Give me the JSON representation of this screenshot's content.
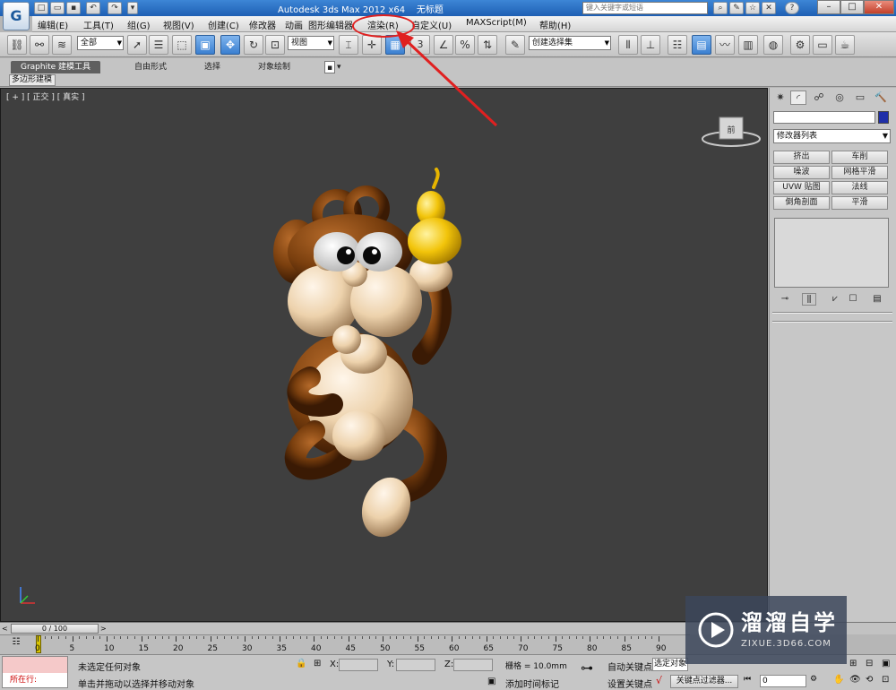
{
  "window": {
    "title": "Autodesk 3ds Max  2012 x64",
    "doc_title": "无标题",
    "search_placeholder": "键入关键字或短语",
    "help_icon": "question-icon",
    "logo_text": "G"
  },
  "menu": {
    "items": [
      "编辑(E)",
      "工具(T)",
      "组(G)",
      "视图(V)",
      "创建(C)",
      "修改器",
      "动画",
      "图形编辑器",
      "渲染(R)",
      "自定义(U)",
      "MAXScript(M)",
      "帮助(H)"
    ]
  },
  "toolbar": {
    "selection_filter": "全部",
    "ref_coord": "视图",
    "named_selection": "创建选择集",
    "snap_label": "3"
  },
  "ribbon": {
    "tabs": [
      "Graphite 建模工具",
      "自由形式",
      "选择",
      "对象绘制"
    ],
    "sub_tab": "多边形建模"
  },
  "viewport": {
    "label": "[ + ] [ 正交 ] [ 真实 ]",
    "viewcube_label": "前"
  },
  "command_panel": {
    "modifier_list": "修改器列表",
    "buttons": [
      "挤出",
      "车削",
      "噪波",
      "网格平滑",
      "UVW 贴图",
      "法线",
      "倒角剖面",
      "平滑"
    ],
    "object_color": "#1f2fa8"
  },
  "timeline": {
    "slider": "0 / 100",
    "ticks": [
      "0",
      "5",
      "10",
      "15",
      "20",
      "25",
      "30",
      "35",
      "40",
      "45",
      "50",
      "55",
      "60",
      "65",
      "70",
      "75",
      "80",
      "85",
      "90"
    ]
  },
  "status": {
    "maxscript_label": "所在行:",
    "selection_msg": "未选定任何对象",
    "prompt_msg": "单击并拖动以选择并移动对象",
    "x_label": "X:",
    "y_label": "Y:",
    "z_label": "Z:",
    "grid": "栅格 = 10.0mm",
    "add_time_tag": "添加时间标记",
    "auto_key": "自动关键点",
    "selected_object": "选定对象",
    "set_key": "设置关键点",
    "key_filters": "关键点过滤器...",
    "frame": "0"
  },
  "watermark": {
    "main": "溜溜自学",
    "sub": "ZIXUE.3D66.COM"
  },
  "colors": {
    "viewport_bg": "#3f3f3f",
    "annotation": "#e02020",
    "monkey_fur": "#7a3f0e",
    "monkey_skin": "#edd2ac",
    "gourd": "#f2c40a"
  }
}
